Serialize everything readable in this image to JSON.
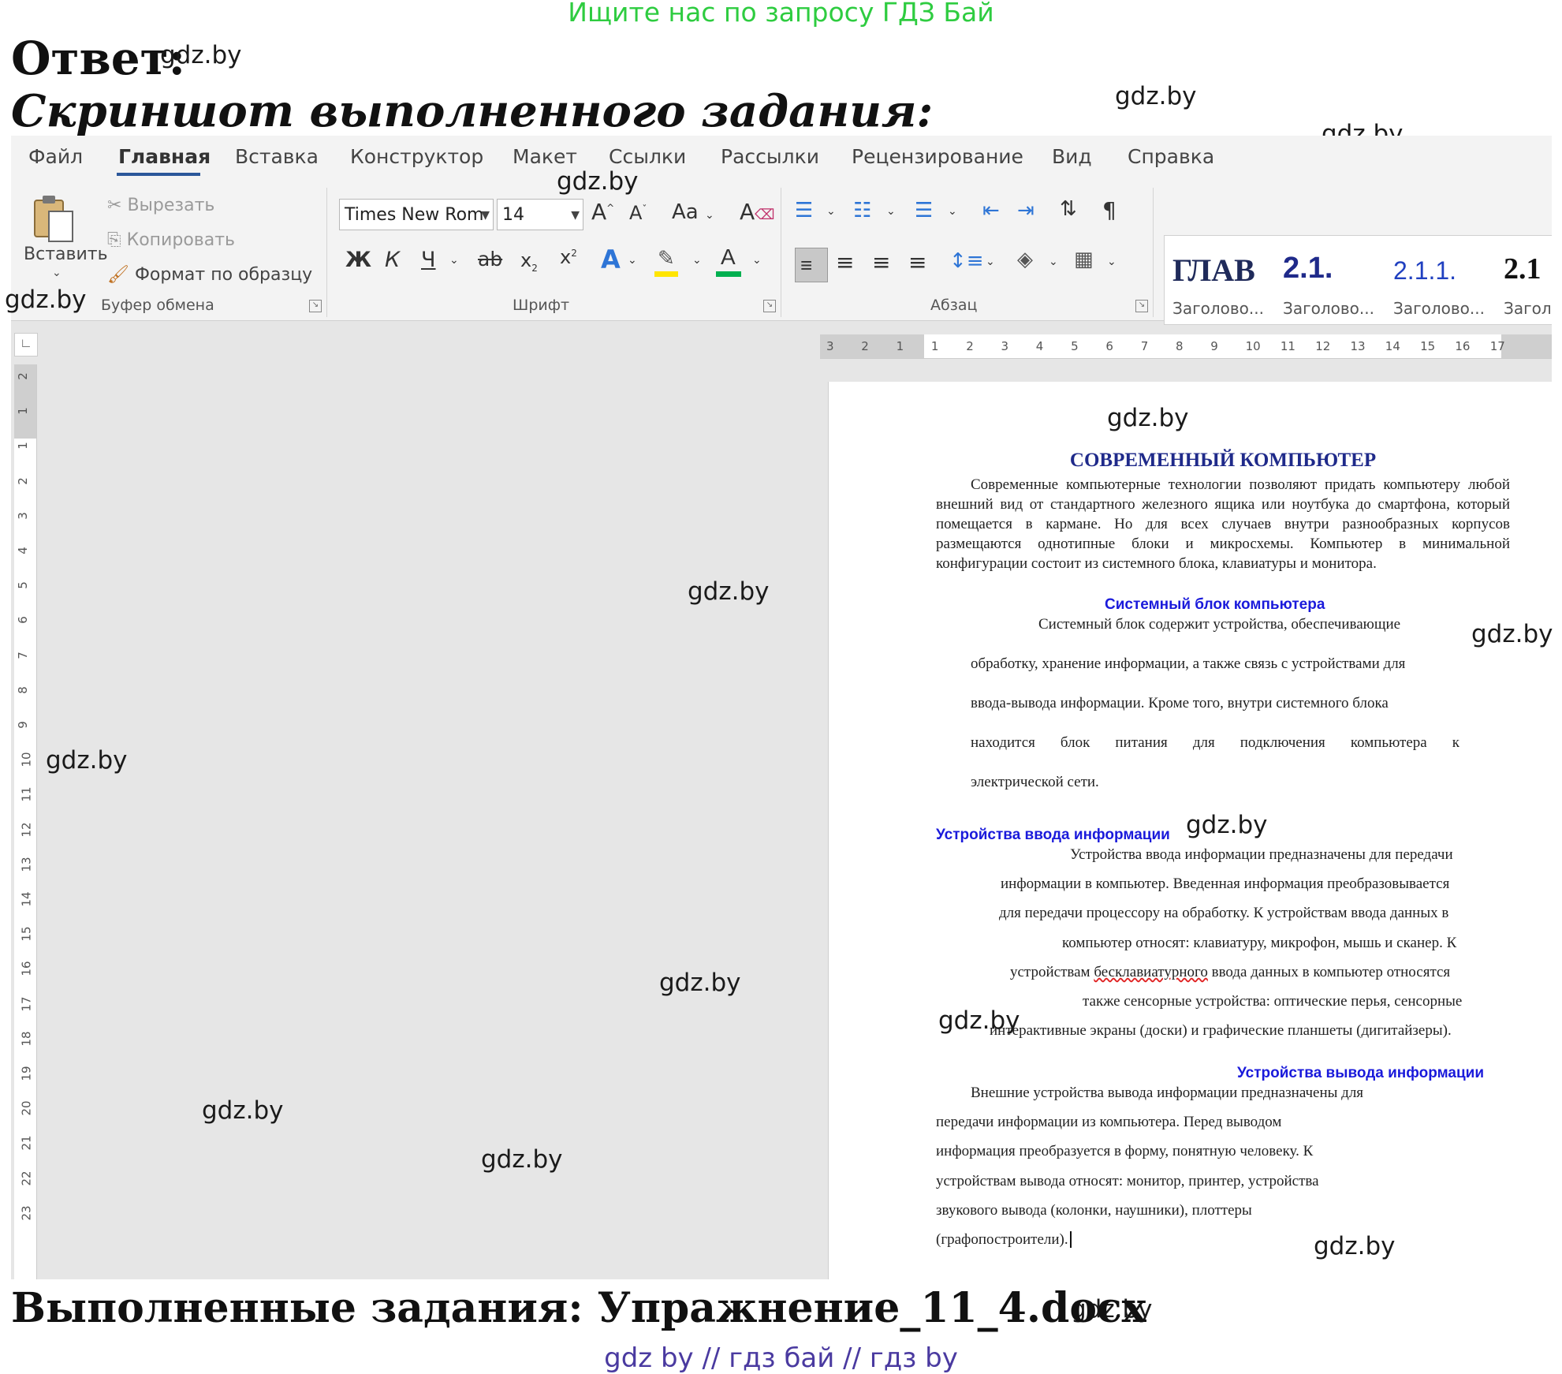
{
  "header": {
    "promo": "Ищите нас по запросу ГДЗ Бай"
  },
  "answer_label": "Ответ:",
  "subtitle": "Скриншот выполненного задания:",
  "watermark": "gdz.by",
  "tabs": [
    "Файл",
    "Главная",
    "Вставка",
    "Конструктор",
    "Макет",
    "Ссылки",
    "Рассылки",
    "Рецензирование",
    "Вид",
    "Справка"
  ],
  "clipboard": {
    "paste_label": "Вставить",
    "cut_label": "Вырезать",
    "copy_label": "Копировать",
    "format_painter_label": "Формат по образцу",
    "group_label": "Буфер обмена"
  },
  "font": {
    "font_name": "Times New Rom",
    "font_size": "14",
    "grow_label": "A",
    "shrink_label": "A",
    "case_label": "Aa",
    "bold_label": "Ж",
    "italic_label": "К",
    "underline_label": "Ч",
    "strike_label": "ab",
    "subscript_label": "x",
    "superscript_label": "x",
    "group_label": "Шрифт"
  },
  "paragraph": {
    "group_label": "Абзац"
  },
  "styles": [
    {
      "sample": "ГЛАВ",
      "name": "Заголово..."
    },
    {
      "sample": "2.1.",
      "name": "Заголово..."
    },
    {
      "sample": "2.1.1.",
      "name": "Заголово..."
    },
    {
      "sample": "2.1",
      "name": "Загол"
    }
  ],
  "hruler_labels": [
    "3",
    "2",
    "1",
    "1",
    "2",
    "3",
    "4",
    "5",
    "6",
    "7",
    "8",
    "9",
    "10",
    "11",
    "12",
    "13",
    "14",
    "15",
    "16",
    "17"
  ],
  "vruler_labels": [
    "2",
    "1",
    "1",
    "2",
    "3",
    "4",
    "5",
    "6",
    "7",
    "8",
    "9",
    "10",
    "11",
    "12",
    "13",
    "14",
    "15",
    "16",
    "17",
    "18",
    "19",
    "20",
    "21",
    "22",
    "23"
  ],
  "document": {
    "title": "СОВРЕМЕННЫЙ КОМПЬЮТЕР",
    "intro": "Современные компьютерные технологии позволяют придать компьютеру любой внешний вид от стандартного железного ящика или ноутбука до смартфона, который помещается в кармане. Но для всех случаев внутри разнообразных корпусов размещаются однотипные блоки и микросхемы. Компьютер в минимальной конфигурации состоит из системного блока, клавиатуры и монитора.",
    "h_system": "Системный блок компьютера",
    "system_lines": [
      "Системный блок содержит устройства, обеспечивающие",
      "обработку, хранение информации, а также связь с устройствами для",
      "ввода-вывода информации. Кроме того, внутри системного блока",
      "находится блок питания для подключения компьютера к",
      "электрической сети."
    ],
    "h_input": "Устройства ввода информации",
    "input_lines": [
      "Устройства ввода информации предназначены для передачи",
      "информации в компьютер. Введенная информация преобразовывается",
      "для передачи процессору на обработку. К устройствам ввода данных в",
      "компьютер относят: клавиатуру, микрофон, мышь и сканер. К",
      "также сенсорные устройства: оптические перья, сенсорные",
      "интерактивные экраны (доски) и графические планшеты (дигитайзеры)."
    ],
    "input_line5_a": "устройствам ",
    "input_line5_b": "бесклавиатурного",
    "input_line5_c": " ввода данных в компьютер относятся",
    "h_output": "Устройства вывода информации",
    "output_lines": [
      "Внешние устройства вывода информации предназначены для",
      "передачи информации из компьютера. Перед выводом",
      "информация преобразуется в форму, понятную человеку. К",
      "устройствам вывода относят: монитор, принтер, устройства",
      "звукового вывода (колонки, наушники), плоттеры",
      "(графопостроители)."
    ]
  },
  "footer": {
    "title": "Выполненные задания: Упражнение_11_4.docx",
    "links": "gdz by  //  гдз бай  //  гдз by"
  }
}
